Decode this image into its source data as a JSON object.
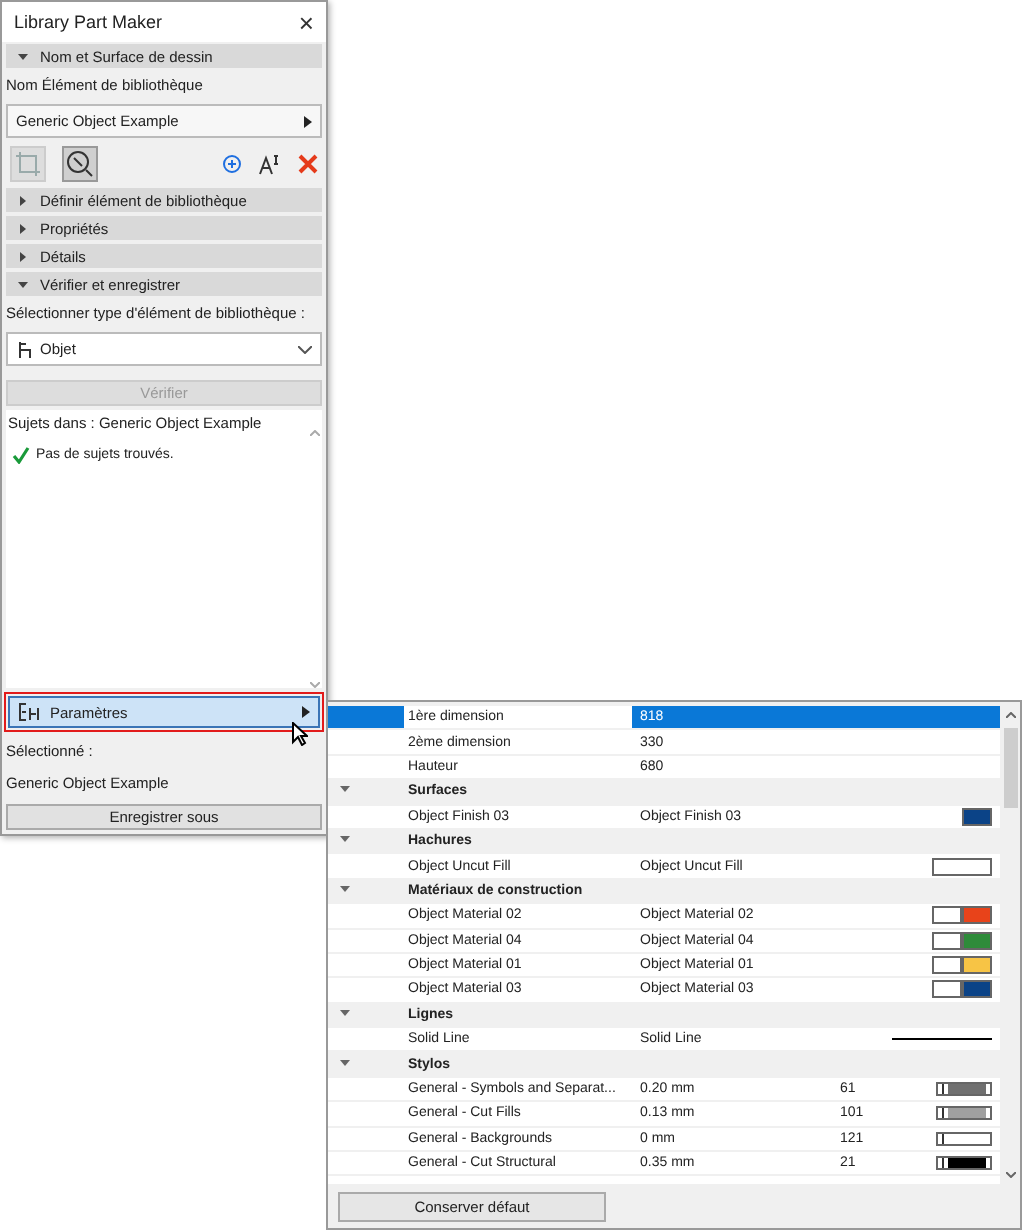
{
  "window": {
    "title": "Library Part Maker",
    "close": "×"
  },
  "top_section": {
    "label": "Nom et Surface de dessin",
    "expanded": true
  },
  "name_label": "Nom Élément de bibliothèque",
  "name_dropdown": {
    "value": "Generic Object Example"
  },
  "sections": [
    {
      "label": "Définir élément de bibliothèque",
      "expanded": false
    },
    {
      "label": "Propriétés",
      "expanded": false
    },
    {
      "label": "Détails",
      "expanded": false
    },
    {
      "label": "Vérifier et enregistrer",
      "expanded": true
    }
  ],
  "type_label": "Sélectionner type d'élément de bibliothèque :",
  "type_select": {
    "value": "Objet"
  },
  "verify_button": {
    "label": "Vérifier",
    "disabled": true
  },
  "issues": {
    "title": "Sujets dans : Generic Object Example",
    "message": "Pas de sujets trouvés."
  },
  "params_button": {
    "label": "Paramètres",
    "selected": true
  },
  "selected_label": "Sélectionné :",
  "selected_value": "Generic Object Example",
  "save_button": "Enregistrer sous",
  "params_table": {
    "rows": [
      {
        "kind": "param",
        "name": "1ère dimension",
        "value": "818",
        "selected": true
      },
      {
        "kind": "param",
        "name": "2ème dimension",
        "value": "330",
        "selected": false
      },
      {
        "kind": "param",
        "name": "Hauteur",
        "value": "680",
        "selected": false
      },
      {
        "kind": "group",
        "name": "Surfaces",
        "expanded": true
      },
      {
        "kind": "param",
        "name": "Object Finish 03",
        "value": "Object Finish 03",
        "swatch": {
          "kind": "color",
          "color": "#0b4387"
        },
        "selected": false
      },
      {
        "kind": "group",
        "name": "Hachures",
        "expanded": true
      },
      {
        "kind": "param",
        "name": "Object Uncut Fill",
        "value": "Object Uncut Fill",
        "swatch": {
          "kind": "fill"
        },
        "selected": false
      },
      {
        "kind": "group",
        "name": "Matériaux de construction",
        "expanded": true
      },
      {
        "kind": "param",
        "name": "Object Material 02",
        "value": "Object Material 02",
        "swatch": {
          "kind": "material",
          "color": "#e8431a"
        },
        "selected": false
      },
      {
        "kind": "param",
        "name": "Object Material 04",
        "value": "Object Material 04",
        "swatch": {
          "kind": "material",
          "color": "#2e8b3a"
        },
        "selected": false
      },
      {
        "kind": "param",
        "name": "Object Material 01",
        "value": "Object Material 01",
        "swatch": {
          "kind": "material",
          "color": "#f7c445"
        },
        "selected": false
      },
      {
        "kind": "param",
        "name": "Object Material 03",
        "value": "Object Material 03",
        "swatch": {
          "kind": "material",
          "color": "#0b4387"
        },
        "selected": false
      },
      {
        "kind": "group",
        "name": "Lignes",
        "expanded": true
      },
      {
        "kind": "param",
        "name": "Solid Line",
        "value": "Solid Line",
        "swatch": {
          "kind": "line"
        },
        "selected": false
      },
      {
        "kind": "group",
        "name": "Stylos",
        "expanded": true
      },
      {
        "kind": "param",
        "name": "General - Symbols and Separat...",
        "value": "0.20 mm",
        "number": "61",
        "swatch": {
          "kind": "pen",
          "color": "#707070"
        },
        "selected": false
      },
      {
        "kind": "param",
        "name": "General - Cut Fills",
        "value": "0.13 mm",
        "number": "101",
        "swatch": {
          "kind": "pen",
          "color": "#a0a0a0"
        },
        "selected": false
      },
      {
        "kind": "param",
        "name": "General - Backgrounds",
        "value": "0 mm",
        "number": "121",
        "swatch": {
          "kind": "pen",
          "color": "#ffffff"
        },
        "selected": false
      },
      {
        "kind": "param",
        "name": "General - Cut Structural",
        "value": "0.35 mm",
        "number": "21",
        "swatch": {
          "kind": "pen",
          "color": "#000000"
        },
        "selected": false
      }
    ]
  },
  "default_button": "Conserver défaut"
}
